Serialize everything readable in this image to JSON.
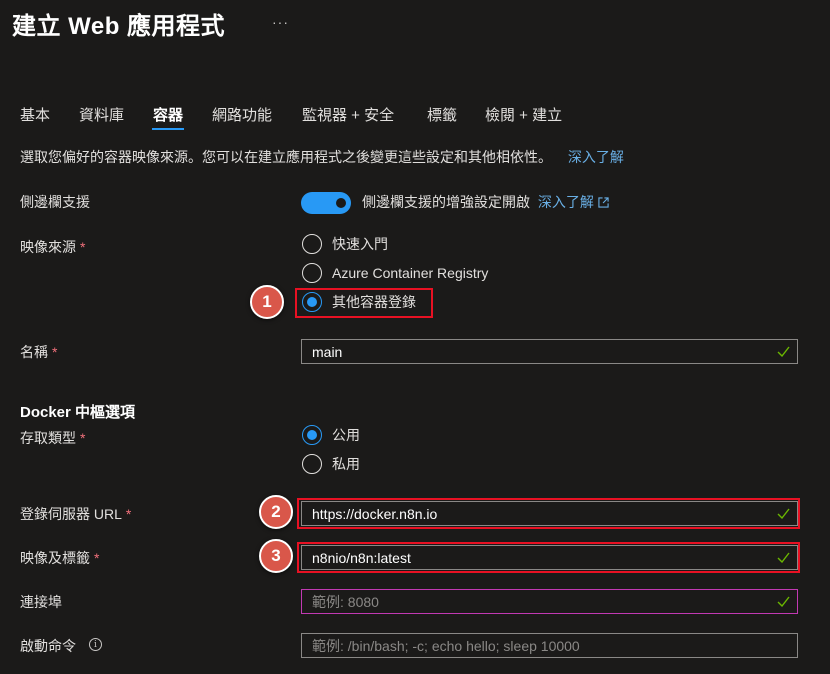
{
  "header": {
    "title": "建立 Web 應用程式",
    "more": "···"
  },
  "tabs": [
    {
      "label": "基本",
      "active": false
    },
    {
      "label": "資料庫",
      "active": false
    },
    {
      "label": "容器",
      "active": true
    },
    {
      "label": "網路功能",
      "active": false
    },
    {
      "label": "監視器 + 安全",
      "active": false
    },
    {
      "label": "標籤",
      "active": false
    },
    {
      "label": "檢閱 + 建立",
      "active": false
    }
  ],
  "intro": {
    "text": "選取您偏好的容器映像來源。您可以在建立應用程式之後變更這些設定和其他相依性。",
    "link": "深入了解"
  },
  "sidecar": {
    "label": "側邊欄支援",
    "toggle_on": true,
    "toggle_text": "側邊欄支援的增強設定開啟",
    "link": "深入了解"
  },
  "image_source": {
    "label": "映像來源",
    "required": "*",
    "options": [
      {
        "label": "快速入門",
        "checked": false
      },
      {
        "label": "Azure Container Registry",
        "checked": false
      },
      {
        "label": "其他容器登錄",
        "checked": true
      }
    ]
  },
  "name": {
    "label": "名稱",
    "required": "*",
    "value": "main"
  },
  "docker_section": {
    "title": "Docker 中樞選項"
  },
  "access_type": {
    "label": "存取類型",
    "required": "*",
    "options": [
      {
        "label": "公用",
        "checked": true
      },
      {
        "label": "私用",
        "checked": false
      }
    ]
  },
  "registry_url": {
    "label": "登錄伺服器 URL",
    "required": "*",
    "value": "https://docker.n8n.io"
  },
  "image_tag": {
    "label": "映像及標籤",
    "required": "*",
    "value": "n8nio/n8n:latest"
  },
  "port": {
    "label": "連接埠",
    "placeholder": "範例: 8080"
  },
  "startup": {
    "label": "啟動命令",
    "info": "i",
    "placeholder": "範例: /bin/bash; -c; echo hello; sleep 10000"
  },
  "markers": [
    "1",
    "2",
    "3"
  ],
  "colors": {
    "accent": "#2899f5",
    "highlight": "#e81123",
    "marker": "#d9574a",
    "valid": "#6bb700",
    "focus": "#c239b3"
  }
}
